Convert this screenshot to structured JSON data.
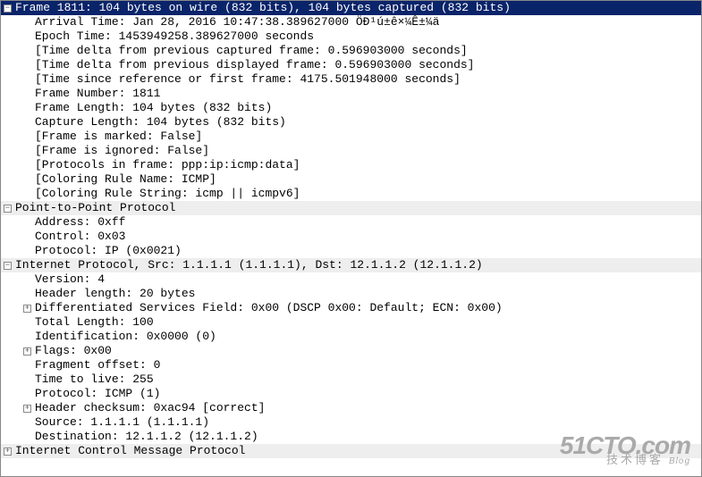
{
  "frame": {
    "header": "Frame 1811: 104 bytes on wire (832 bits), 104 bytes captured (832 bits)",
    "arrival": "Arrival Time: Jan 28, 2016 10:47:38.389627000 ÖÐ¹ú±ê×¼Ê±¼ä",
    "epoch": "Epoch Time: 1453949258.389627000 seconds",
    "delta_cap": "[Time delta from previous captured frame: 0.596903000 seconds]",
    "delta_disp": "[Time delta from previous displayed frame: 0.596903000 seconds]",
    "since_ref": "[Time since reference or first frame: 4175.501948000 seconds]",
    "number": "Frame Number: 1811",
    "length": "Frame Length: 104 bytes (832 bits)",
    "capture": "Capture Length: 104 bytes (832 bits)",
    "marked": "[Frame is marked: False]",
    "ignored": "[Frame is ignored: False]",
    "protocols": "[Protocols in frame: ppp:ip:icmp:data]",
    "color_name": "[Coloring Rule Name: ICMP]",
    "color_string": "[Coloring Rule String: icmp || icmpv6]"
  },
  "ppp": {
    "header": "Point-to-Point Protocol",
    "address": "Address: 0xff",
    "control": "Control: 0x03",
    "protocol": "Protocol: IP (0x0021)"
  },
  "ip": {
    "header": "Internet Protocol, Src: 1.1.1.1 (1.1.1.1), Dst: 12.1.1.2 (12.1.1.2)",
    "version": "Version: 4",
    "hdrlen": "Header length: 20 bytes",
    "dscp": "Differentiated Services Field: 0x00 (DSCP 0x00: Default; ECN: 0x00)",
    "totlen": "Total Length: 100",
    "ident": "Identification: 0x0000 (0)",
    "flags": "Flags: 0x00",
    "fragoff": "Fragment offset: 0",
    "ttl": "Time to live: 255",
    "proto": "Protocol: ICMP (1)",
    "cksum": "Header checksum: 0xac94 [correct]",
    "src": "Source: 1.1.1.1 (1.1.1.1)",
    "dst": "Destination: 12.1.1.2 (12.1.1.2)"
  },
  "icmp": {
    "header": "Internet Control Message Protocol"
  },
  "glyph": {
    "minus": "−",
    "plus": "+"
  },
  "watermark": {
    "big": "51CTO.com",
    "sml": "技术博客",
    "blog": "Blog"
  }
}
